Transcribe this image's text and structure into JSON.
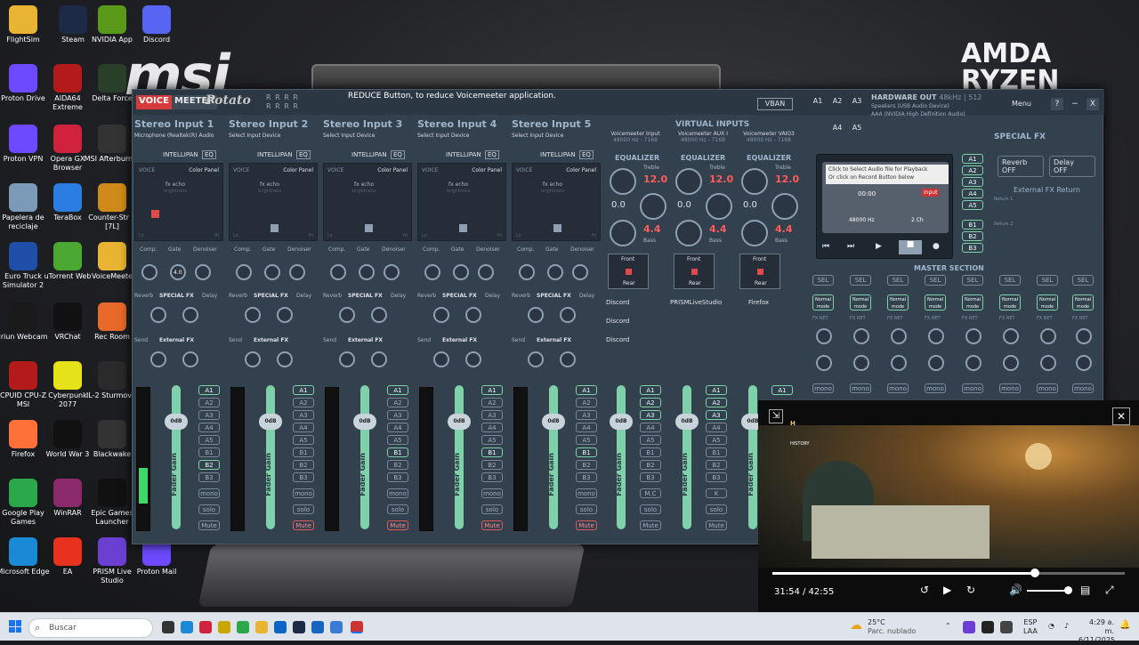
{
  "desktop": {
    "brand_left": "msi",
    "brand_right": "AMDA RYZEN",
    "icons": [
      {
        "label": "FlightSim",
        "color": "#e8b431"
      },
      {
        "label": "Steam",
        "color": "#1c2a45"
      },
      {
        "label": "NVIDIA App",
        "color": "#5a9a1a"
      },
      {
        "label": "Discord",
        "color": "#5865f2"
      },
      {
        "label": "Proton Drive",
        "color": "#6d4aff"
      },
      {
        "label": "AIDA64 Extreme",
        "color": "#b31b1b"
      },
      {
        "label": "Delta Force",
        "color": "#2a3f2a"
      },
      {
        "label": "Proton VPN",
        "color": "#6d4aff"
      },
      {
        "label": "Opera GX Browser",
        "color": "#d0213d"
      },
      {
        "label": "MSI Afterburner",
        "color": "#333333"
      },
      {
        "label": "Papelera de reciclaje",
        "color": "#7a9ab8"
      },
      {
        "label": "TeraBox",
        "color": "#2a7de1"
      },
      {
        "label": "Counter-Str 2 [7L]",
        "color": "#d08a1a"
      },
      {
        "label": "Euro Truck Simulator 2",
        "color": "#1f4fa8"
      },
      {
        "label": "uTorrent Web",
        "color": "#4aa832"
      },
      {
        "label": "VoiceMeete",
        "color": "#e8b431"
      },
      {
        "label": "Iriun Webcam",
        "color": "#1a1a1a"
      },
      {
        "label": "VRChat",
        "color": "#111111"
      },
      {
        "label": "Rec Room",
        "color": "#e86a2a"
      },
      {
        "label": "CPUID CPU-Z MSI",
        "color": "#b31b1b"
      },
      {
        "label": "Cyberpunk 2077",
        "color": "#e6e21a"
      },
      {
        "label": "IL-2 Sturmov...",
        "color": "#2a2a2a"
      },
      {
        "label": "Firefox",
        "color": "#ff7139"
      },
      {
        "label": "World War 3",
        "color": "#111111"
      },
      {
        "label": "Blackwake",
        "color": "#333333"
      },
      {
        "label": "Google Play Games",
        "color": "#2aa84a"
      },
      {
        "label": "WinRAR",
        "color": "#8a2a6a"
      },
      {
        "label": "Epic Games Launcher",
        "color": "#111111"
      },
      {
        "label": "Microsoft Edge",
        "color": "#1a8ad6"
      },
      {
        "label": "EA",
        "color": "#e8321e"
      },
      {
        "label": "PRISM Live Studio",
        "color": "#6a3fd1"
      },
      {
        "label": "Proton Mail",
        "color": "#6d4aff"
      }
    ]
  },
  "vm": {
    "logo_voice": "VOICE",
    "logo_meeter": "MEETER",
    "logo_potato": "Potato",
    "tooltip": "REDUCE Button, to reduce Voicemeeter application.",
    "vban": "VBAN",
    "menu": "Menu",
    "help": "?",
    "close": "X",
    "hw_title": "HARDWARE OUT",
    "hw_rate": "48kHz | 512",
    "hw_dev1": "Speakers (USB Audio Device)",
    "hw_dev2": "AAA (NVIDIA High Definition Audio)",
    "a_buttons": [
      "A1",
      "A2",
      "A3",
      "A4",
      "A5"
    ],
    "inputs": [
      {
        "title": "Stereo Input 1",
        "sub": "Microphone (Realtek(R) Audio"
      },
      {
        "title": "Stereo Input 2",
        "sub": "Select Input Device"
      },
      {
        "title": "Stereo Input 3",
        "sub": "Select Input Device"
      },
      {
        "title": "Stereo Input 4",
        "sub": "Select Input Device"
      },
      {
        "title": "Stereo Input 5",
        "sub": "Select Input Device"
      }
    ],
    "virtual_head": "VIRTUAL INPUTS",
    "virtual": [
      {
        "title": "Voicemeeter Input",
        "sub": "48000 Hz - 7168"
      },
      {
        "title": "Voicemeeter AUX I",
        "sub": "48000 Hz - 7168"
      },
      {
        "title": "Voicemeeter VAIO3",
        "sub": "48000 Hz - 7168"
      }
    ],
    "strip_labels": {
      "intellipan": "INTELLIPAN",
      "eq": "EQ",
      "voice": "VOICE",
      "color_panel": "Color Panel",
      "fx_echo": "fx echo",
      "brightness": "brightness",
      "lo": "Lo",
      "hi": "Hi",
      "comp": "Comp.",
      "gate": "Gate",
      "denoiser": "Denoiser",
      "reverb": "Reverb",
      "special_fx": "SPECIAL FX",
      "delay": "Delay",
      "send": "Send",
      "external_fx": "External FX",
      "fader_gain": "Fader Gain",
      "db": "0dB",
      "mono": "mono",
      "solo": "solo",
      "mute": "Mute",
      "mc": "M.C",
      "k": "K",
      "gate_val": "4.0"
    },
    "buses": [
      "A1",
      "A2",
      "A3",
      "A4",
      "A5",
      "B1",
      "B2",
      "B3"
    ],
    "equalizer": "EQUALIZER",
    "treble": "Treble",
    "bass": "Bass",
    "treble_val": "12.0",
    "mid_val": "0.0",
    "bass_val": "4.4",
    "front": "Front",
    "rear": "Rear",
    "apps": [
      "Discord",
      "Discord",
      "Discord"
    ],
    "apps2": [
      "PRISMLiveStudio",
      "Firefox"
    ],
    "recorder_tip1": "Click to Select Audio file for Playback",
    "recorder_tip2": "Or click on Record Button below",
    "rec_time": "00:00",
    "rec_input": "input",
    "rec_rate": "48000 Hz",
    "rec_ch": "2 Ch",
    "special_fx": "SPECIAL FX",
    "reverb_btn": "Reverb",
    "delay_btn": "Delay",
    "off": "OFF",
    "ext_return": "External FX Return",
    "return1": "Return 1",
    "return2": "Return 2",
    "master": "MASTER SECTION",
    "sel": "SEL",
    "normal_mode": "Normal mode",
    "fx_ret": "FX RET"
  },
  "video": {
    "channel": "HISTORY",
    "time": "31:54 / 42:55",
    "progress": 0.744
  },
  "taskbar": {
    "search": "Buscar",
    "weather_temp": "25°C",
    "weather_desc": "Parc. nublado",
    "lang1": "ESP",
    "lang2": "LAA",
    "time": "4:29 a. m.",
    "date": "6/11/2025"
  }
}
